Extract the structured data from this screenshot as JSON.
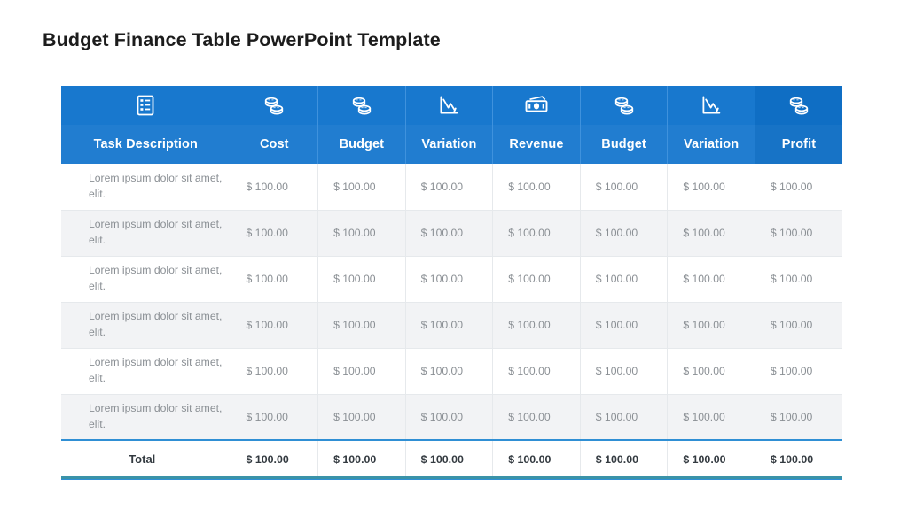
{
  "slide": {
    "title": "Budget Finance Table PowerPoint Template",
    "accent_blue": "#1878ce",
    "accent_blue_dark": "#0f6ec4",
    "total_border": "#2f8fd4",
    "bottom_bar": "#3a93a8",
    "stripe_gray": "#f2f3f5",
    "body_text": "#8a8f94"
  },
  "table": {
    "headers": [
      {
        "label": "Task Description",
        "icon": "checklist-icon"
      },
      {
        "label": "Cost",
        "icon": "coins-icon"
      },
      {
        "label": "Budget",
        "icon": "coins-icon"
      },
      {
        "label": "Variation",
        "icon": "line-chart-icon"
      },
      {
        "label": "Revenue",
        "icon": "banknote-icon"
      },
      {
        "label": "Budget",
        "icon": "coins-icon"
      },
      {
        "label": "Variation",
        "icon": "line-chart-icon"
      },
      {
        "label": "Profit",
        "icon": "coins-icon"
      }
    ],
    "rows": [
      {
        "task": "Lorem ipsum dolor sit amet, elit.",
        "values": [
          "$ 100.00",
          "$ 100.00",
          "$ 100.00",
          "$ 100.00",
          "$ 100.00",
          "$ 100.00",
          "$ 100.00"
        ]
      },
      {
        "task": "Lorem ipsum dolor sit amet, elit.",
        "values": [
          "$ 100.00",
          "$ 100.00",
          "$ 100.00",
          "$ 100.00",
          "$ 100.00",
          "$ 100.00",
          "$ 100.00"
        ]
      },
      {
        "task": "Lorem ipsum dolor sit amet, elit.",
        "values": [
          "$ 100.00",
          "$ 100.00",
          "$ 100.00",
          "$ 100.00",
          "$ 100.00",
          "$ 100.00",
          "$ 100.00"
        ]
      },
      {
        "task": "Lorem ipsum dolor sit amet, elit.",
        "values": [
          "$ 100.00",
          "$ 100.00",
          "$ 100.00",
          "$ 100.00",
          "$ 100.00",
          "$ 100.00",
          "$ 100.00"
        ]
      },
      {
        "task": "Lorem ipsum dolor sit amet, elit.",
        "values": [
          "$ 100.00",
          "$ 100.00",
          "$ 100.00",
          "$ 100.00",
          "$ 100.00",
          "$ 100.00",
          "$ 100.00"
        ]
      },
      {
        "task": "Lorem ipsum dolor sit amet, elit.",
        "values": [
          "$ 100.00",
          "$ 100.00",
          "$ 100.00",
          "$ 100.00",
          "$ 100.00",
          "$ 100.00",
          "$ 100.00"
        ]
      }
    ],
    "total": {
      "label": "Total",
      "values": [
        "$ 100.00",
        "$ 100.00",
        "$ 100.00",
        "$ 100.00",
        "$ 100.00",
        "$ 100.00",
        "$ 100.00"
      ]
    }
  }
}
